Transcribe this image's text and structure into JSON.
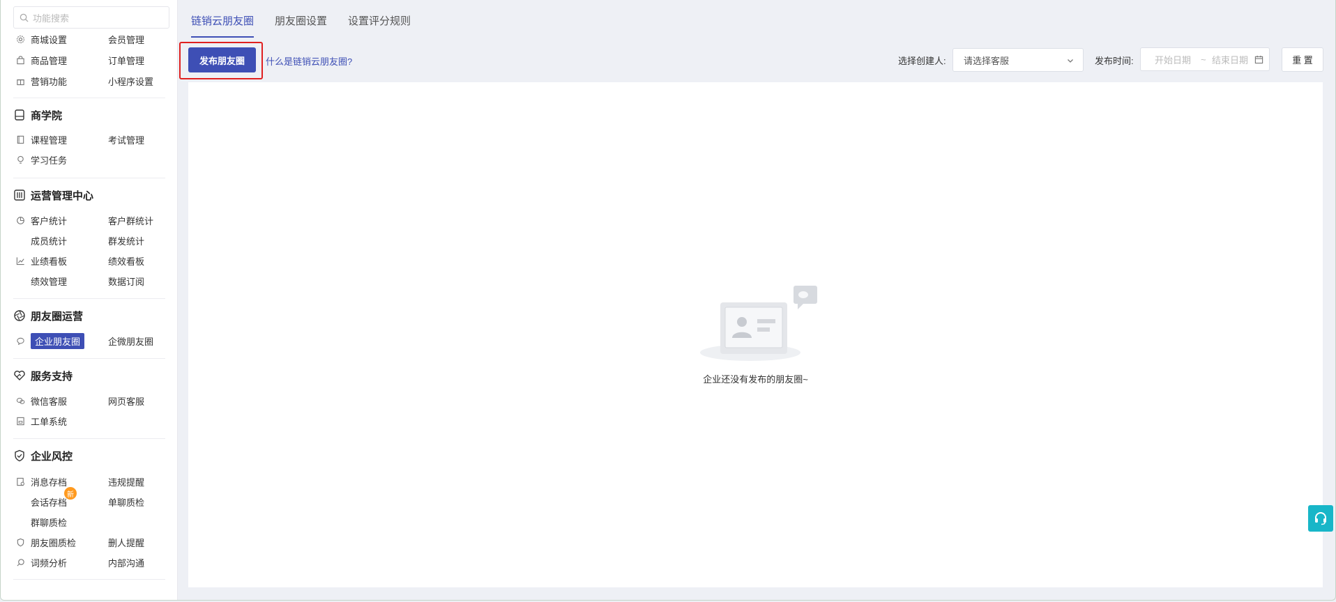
{
  "search": {
    "placeholder": "功能搜索"
  },
  "sidebar": {
    "top_rows": [
      {
        "left": "商城设置",
        "left_icon": "gear-icon",
        "right": "会员管理"
      },
      {
        "left": "商品管理",
        "left_icon": "bag-icon",
        "right": "订单管理"
      },
      {
        "left": "营销功能",
        "left_icon": "gift-icon",
        "right": "小程序设置"
      }
    ],
    "groups": [
      {
        "title": "商学院",
        "icon": "book-icon",
        "rows": [
          {
            "left": "课程管理",
            "right": "考试管理"
          },
          {
            "left": "学习任务"
          }
        ]
      },
      {
        "title": "运营管理中心",
        "icon": "sliders-icon",
        "rows": [
          {
            "left": "客户统计",
            "right": "客户群统计"
          },
          {
            "left": "成员统计",
            "right": "群发统计"
          },
          {
            "left": "业绩看板",
            "right": "绩效看板"
          },
          {
            "left": "绩效管理",
            "right": "数据订阅"
          }
        ]
      },
      {
        "title": "朋友圈运营",
        "icon": "aperture-icon",
        "rows": [
          {
            "left": "企业朋友圈",
            "right": "企微朋友圈"
          }
        ]
      },
      {
        "title": "服务支持",
        "icon": "heart-hand-icon",
        "rows": [
          {
            "left": "微信客服",
            "right": "网页客服"
          },
          {
            "left": "工单系统"
          }
        ]
      },
      {
        "title": "企业风控",
        "icon": "shield-check-icon",
        "rows": [
          {
            "left": "消息存档",
            "right": "违规提醒"
          },
          {
            "left": "会话存档",
            "right": "单聊质检",
            "badge": "新"
          },
          {
            "left": "群聊质检"
          },
          {
            "left": "朋友圈质检",
            "right": "删人提醒"
          },
          {
            "left": "词频分析",
            "right": "内部沟通"
          }
        ]
      }
    ],
    "active_item": "企业朋友圈"
  },
  "tabs": [
    {
      "label": "链销云朋友圈",
      "active": true
    },
    {
      "label": "朋友圈设置",
      "active": false
    },
    {
      "label": "设置评分规则",
      "active": false
    }
  ],
  "toolbar": {
    "publish_label": "发布朋友圈",
    "help_link": "什么是链销云朋友圈?",
    "creator_label": "选择创建人:",
    "creator_placeholder": "请选择客服",
    "time_label": "发布时间:",
    "start_placeholder": "开始日期",
    "range_sep": "~",
    "end_placeholder": "结束日期",
    "reset_label": "重 置"
  },
  "empty": {
    "message": "企业还没有发布的朋友圈~"
  },
  "colors": {
    "accent": "#3e4fb5",
    "highlight_border": "#e02020",
    "badge": "#ff9a1f",
    "support": "#18b6c8"
  }
}
